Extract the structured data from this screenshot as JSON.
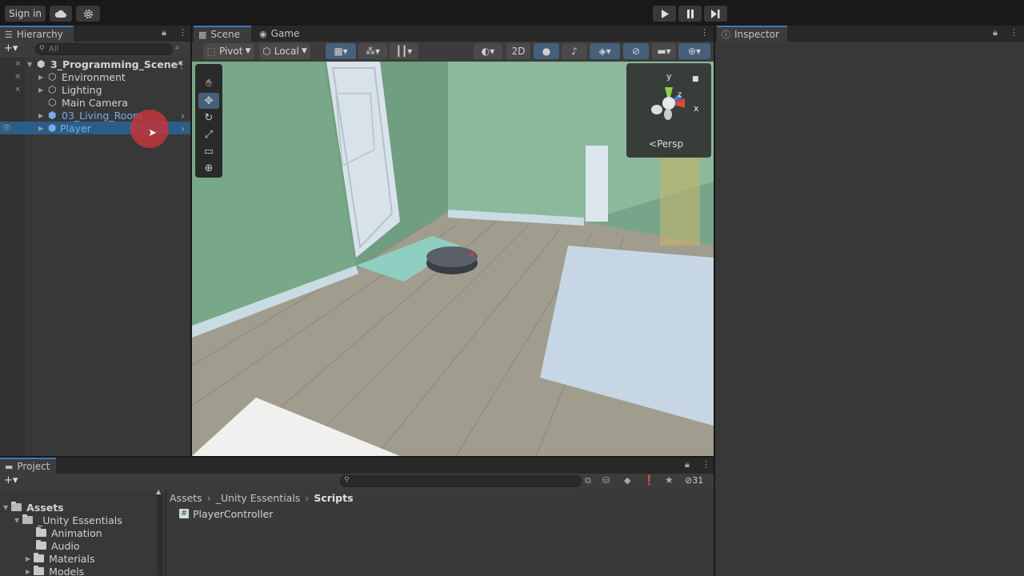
{
  "toolbar": {
    "sign_in": "Sign in",
    "cloud_icon": "cloud-icon",
    "settings_icon": "gear-icon",
    "play_icon": "play-icon",
    "pause_icon": "pause-icon",
    "step_icon": "step-icon"
  },
  "hierarchy": {
    "tab": "Hierarchy",
    "search_placeholder": "All",
    "scene_name": "3_Programming_Scene*",
    "items": [
      {
        "label": "Environment",
        "has_children": true
      },
      {
        "label": "Lighting",
        "has_children": true
      },
      {
        "label": "Main Camera",
        "has_children": false
      },
      {
        "label": "03_Living_Room",
        "has_children": true,
        "prefab": true
      },
      {
        "label": "Player",
        "has_children": true,
        "prefab": true,
        "selected": true
      }
    ]
  },
  "scene": {
    "tab_scene": "Scene",
    "tab_game": "Game",
    "pivot": "Pivot",
    "local": "Local",
    "mode_2d": "2D",
    "persp": "Persp",
    "gizmo_x": "x",
    "gizmo_y": "y",
    "gizmo_z": "z"
  },
  "inspector": {
    "tab": "Inspector"
  },
  "project": {
    "tab": "Project",
    "hidden_count": "31",
    "tree": [
      {
        "label": "Assets",
        "level": 0,
        "bold": true
      },
      {
        "label": "_Unity Essentials",
        "level": 1
      },
      {
        "label": "Animation",
        "level": 2
      },
      {
        "label": "Audio",
        "level": 2
      },
      {
        "label": "Materials",
        "level": 2
      },
      {
        "label": "Models",
        "level": 2
      }
    ],
    "breadcrumb": [
      "Assets",
      "_Unity Essentials",
      "Scripts"
    ],
    "file": "PlayerController"
  },
  "colors": {
    "accent": "#3a79bb",
    "selection": "#2c5d87",
    "prefab_text": "#7aaaf0",
    "panel_bg": "#383838",
    "cursor_highlight": "#c2363c"
  }
}
